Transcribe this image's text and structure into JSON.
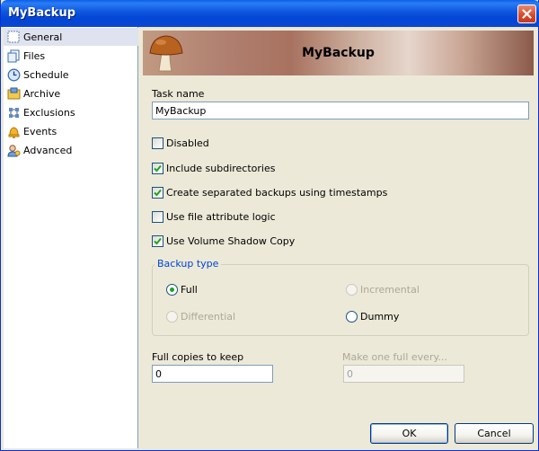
{
  "window": {
    "title": "MyBackup"
  },
  "sidebar": {
    "items": [
      {
        "label": "General",
        "icon": "general-icon",
        "selected": true
      },
      {
        "label": "Files",
        "icon": "files-icon"
      },
      {
        "label": "Schedule",
        "icon": "clock-icon"
      },
      {
        "label": "Archive",
        "icon": "archive-icon"
      },
      {
        "label": "Exclusions",
        "icon": "exclusions-icon"
      },
      {
        "label": "Events",
        "icon": "bell-icon"
      },
      {
        "label": "Advanced",
        "icon": "advanced-icon"
      }
    ]
  },
  "banner": {
    "title": "MyBackup",
    "icon": "mushroom-icon"
  },
  "task": {
    "label": "Task name",
    "value": "MyBackup"
  },
  "options": {
    "disabled": {
      "label": "Disabled",
      "checked": false
    },
    "include_subdirs": {
      "label": "Include subdirectories",
      "checked": true
    },
    "timestamps": {
      "label": "Create separated backups using timestamps",
      "checked": true
    },
    "attr_logic": {
      "label": "Use file attribute logic",
      "checked": false
    },
    "vss": {
      "label": "Use Volume Shadow Copy",
      "checked": true
    }
  },
  "backup_type": {
    "title": "Backup type",
    "full": "Full",
    "incremental": "Incremental",
    "differential": "Differential",
    "dummy": "Dummy",
    "selected": "Full"
  },
  "full_copies": {
    "label": "Full copies to keep",
    "value": "0"
  },
  "make_full": {
    "label": "Make one full every...",
    "value": "0"
  },
  "buttons": {
    "ok": "OK",
    "cancel": "Cancel"
  },
  "colors": {
    "titlebar": "#0345d6",
    "accent": "#0046d5",
    "face": "#ece9d8"
  }
}
